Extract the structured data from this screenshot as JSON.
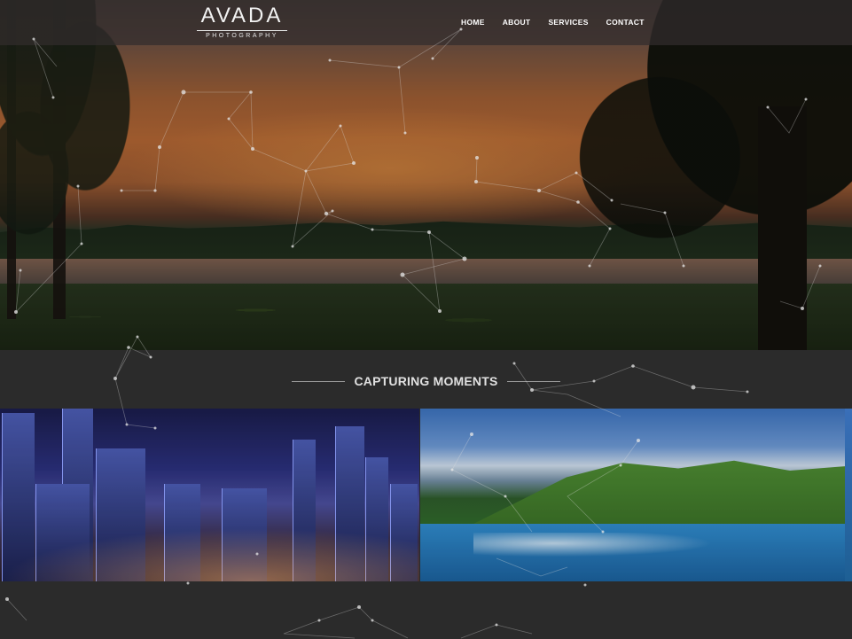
{
  "brand": {
    "logo_word": "AVADA",
    "logo_sub": "PHOTOGRAPHY"
  },
  "nav": {
    "items": [
      {
        "label": "HOME"
      },
      {
        "label": "ABOUT"
      },
      {
        "label": "SERVICES"
      },
      {
        "label": "CONTACT"
      }
    ]
  },
  "section": {
    "title": "CAPTURING MOMENTS"
  },
  "colors": {
    "background": "#2b2b2b",
    "nav_bg": "rgba(50,45,45,0.72)",
    "text": "#ffffff",
    "section_text": "#e0e0e0"
  },
  "gallery": {
    "items": [
      {
        "name": "city-skyline-photo"
      },
      {
        "name": "island-coast-photo"
      }
    ]
  }
}
